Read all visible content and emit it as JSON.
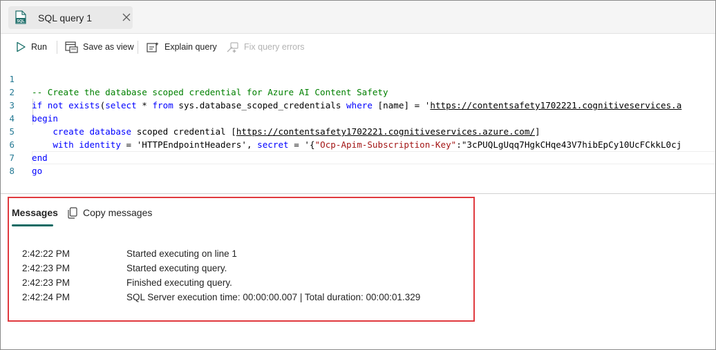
{
  "tab": {
    "title": "SQL query 1",
    "icon": "sql-file-icon"
  },
  "toolbar": {
    "run_label": "Run",
    "save_as_view_label": "Save as view",
    "explain_query_label": "Explain query",
    "fix_query_errors_label": "Fix query errors"
  },
  "editor": {
    "line_numbers": [
      "1",
      "2",
      "3",
      "4",
      "5",
      "6",
      "7",
      "8"
    ],
    "lines": [
      "-- Create the database scoped credential for Azure AI Content Safety",
      "if not exists(select * from sys.database_scoped_credentials where [name] = 'https://contentsafety1702221.cognitiveservices.a",
      "begin",
      "    create database scoped credential [https://contentsafety1702221.cognitiveservices.azure.com/]",
      "    with identity = 'HTTPEndpointHeaders', secret = '{\"Ocp-Apim-Subscription-Key\":\"3cPUQLgUqq7HgkCHqe43V7hibEpCy10UcFCkkL0cj",
      "end",
      "go",
      ""
    ]
  },
  "messages": {
    "tab_label": "Messages",
    "copy_label": "Copy messages",
    "rows": [
      {
        "time": "2:42:22 PM",
        "text": "Started executing on line 1"
      },
      {
        "time": "2:42:23 PM",
        "text": "Started executing query."
      },
      {
        "time": "2:42:23 PM",
        "text": "Finished executing query."
      },
      {
        "time": "2:42:24 PM",
        "text": "SQL Server execution time: 00:00:00.007 | Total duration: 00:00:01.329"
      }
    ]
  },
  "colors": {
    "keyword": "#0000ff",
    "comment": "#008000",
    "string": "#a31515",
    "line_number": "#237893",
    "accent": "#0f6a63",
    "highlight_border": "#e0393e"
  }
}
